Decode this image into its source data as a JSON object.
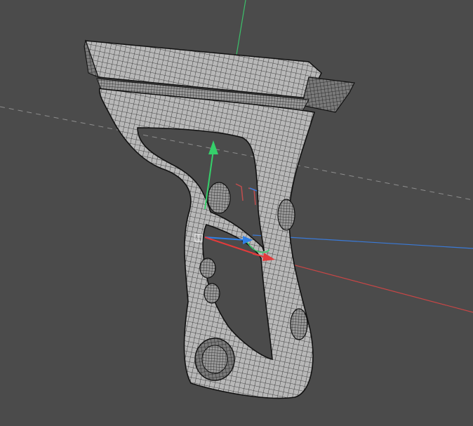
{
  "viewport": {
    "background": "#4b4b4b",
    "grid_axis_colors": {
      "x": "#d04848",
      "y": "#3cc06a",
      "z": "#3a7ad8",
      "horizon": "#9a9a9a"
    },
    "model": {
      "mesh_fill": "#b9b9b9",
      "wire_color": "#1a1a1a",
      "shadow_fill": "#2a2a2a"
    },
    "gizmo": {
      "x_color": "#e23b3b",
      "y_color": "#35d06a",
      "z_color": "#2f7fe6",
      "icons": [
        "move-gizmo-icon",
        "pivot-icon"
      ]
    }
  }
}
